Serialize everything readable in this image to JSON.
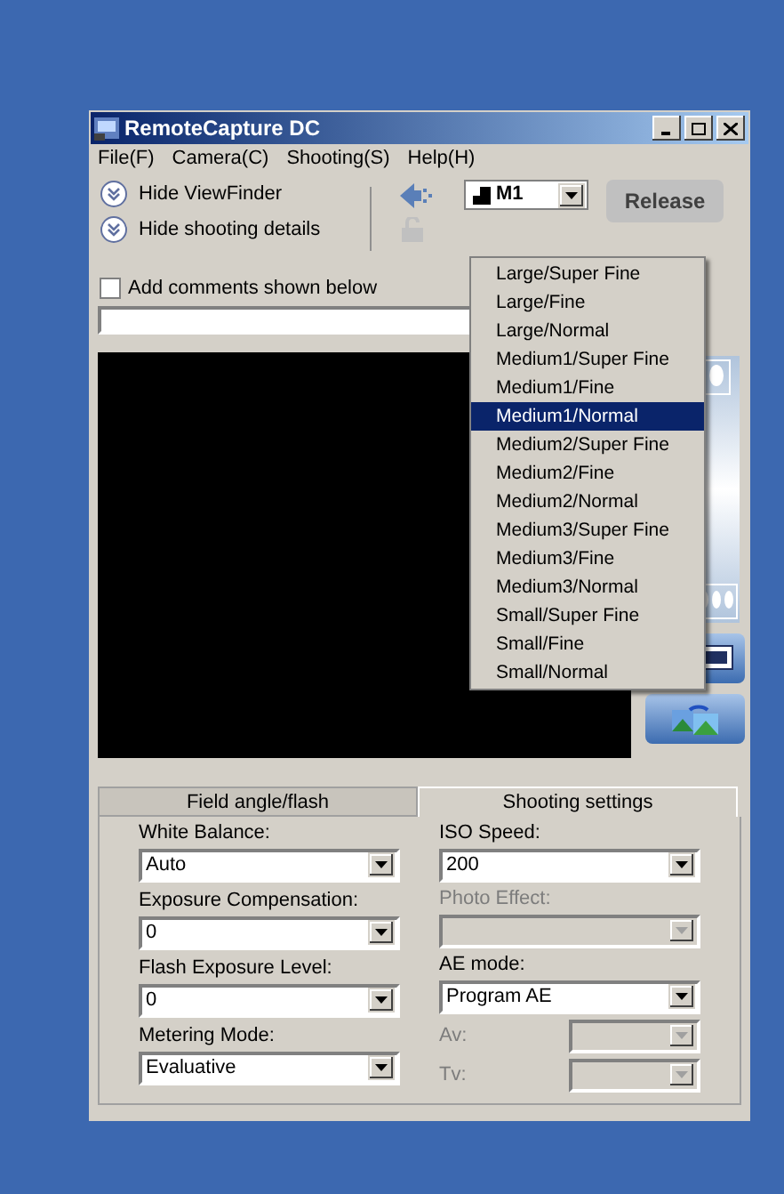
{
  "window": {
    "title": "RemoteCapture DC"
  },
  "menu": [
    "File(F)",
    "Camera(C)",
    "Shooting(S)",
    "Help(H)"
  ],
  "toggles": [
    {
      "label": "Hide ViewFinder"
    },
    {
      "label": "Hide shooting details"
    }
  ],
  "comment": {
    "label": "Add comments shown below",
    "checked": false
  },
  "quality_select": {
    "value": "M1"
  },
  "release_button": {
    "label": "Release"
  },
  "quality_options": [
    {
      "label": "Large/Super Fine",
      "selected": false
    },
    {
      "label": "Large/Fine",
      "selected": false
    },
    {
      "label": "Large/Normal",
      "selected": false
    },
    {
      "label": "Medium1/Super Fine",
      "selected": false
    },
    {
      "label": "Medium1/Fine",
      "selected": false
    },
    {
      "label": "Medium1/Normal",
      "selected": true
    },
    {
      "label": "Medium2/Super Fine",
      "selected": false
    },
    {
      "label": "Medium2/Fine",
      "selected": false
    },
    {
      "label": "Medium2/Normal",
      "selected": false
    },
    {
      "label": "Medium3/Super Fine",
      "selected": false
    },
    {
      "label": "Medium3/Fine",
      "selected": false
    },
    {
      "label": "Medium3/Normal",
      "selected": false
    },
    {
      "label": "Small/Super Fine",
      "selected": false
    },
    {
      "label": "Small/Fine",
      "selected": false
    },
    {
      "label": "Small/Normal",
      "selected": false
    }
  ],
  "tabs": [
    {
      "label": "Field angle/flash",
      "selected": false
    },
    {
      "label": "Shooting settings",
      "selected": true
    }
  ],
  "settings_left": [
    {
      "label": "White Balance:",
      "value": "Auto",
      "disabled": false
    },
    {
      "label": "Exposure Compensation:",
      "value": "0",
      "disabled": false
    },
    {
      "label": "Flash Exposure Level:",
      "value": "0",
      "disabled": false
    },
    {
      "label": "Metering Mode:",
      "value": "Evaluative",
      "disabled": false
    }
  ],
  "settings_right": [
    {
      "label": "ISO Speed:",
      "value": "200",
      "disabled": false,
      "kind": "stacked"
    },
    {
      "label": "Photo Effect:",
      "disabled": true,
      "kind": "stacked"
    },
    {
      "label": "AE mode:",
      "value": "Program AE",
      "disabled": false,
      "kind": "stacked"
    },
    {
      "label": "Av:",
      "disabled": true,
      "kind": "inline"
    },
    {
      "label": "Tv:",
      "disabled": true,
      "kind": "inline"
    }
  ]
}
